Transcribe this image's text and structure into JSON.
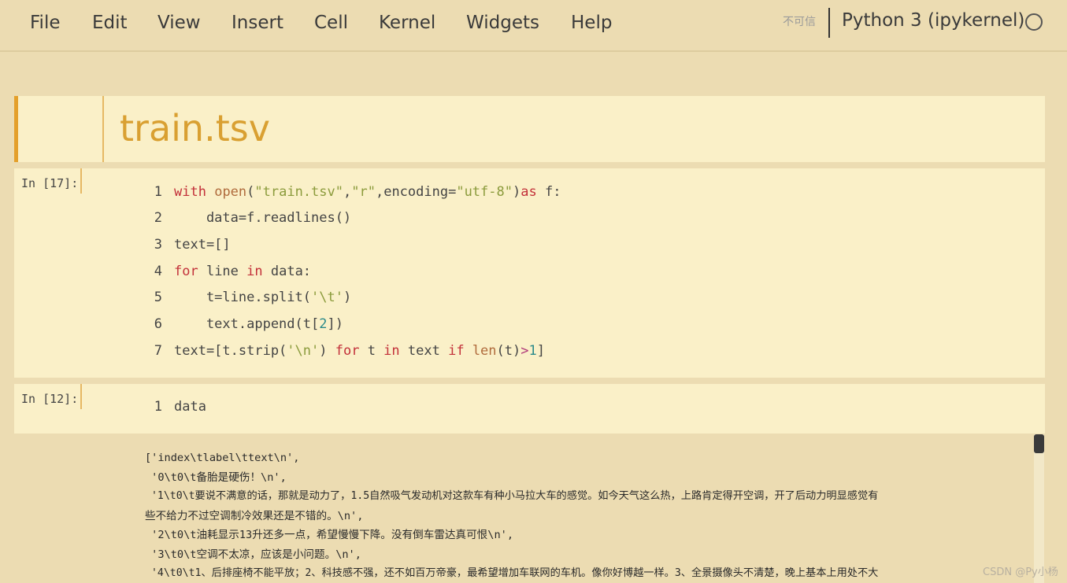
{
  "menubar": {
    "items": [
      "File",
      "Edit",
      "View",
      "Insert",
      "Cell",
      "Kernel",
      "Widgets",
      "Help"
    ],
    "trust_label": "不可信",
    "kernel_name": "Python 3 (ipykernel)"
  },
  "markdown_cell": {
    "title": "train.tsv"
  },
  "cells": [
    {
      "prompt": "In  [17]:",
      "line_numbers": [
        "1",
        "2",
        "3",
        "4",
        "5",
        "6",
        "7"
      ]
    },
    {
      "prompt": "In  [12]:",
      "line_numbers": [
        "1"
      ],
      "code": "data"
    }
  ],
  "output": {
    "lines": [
      "['index\\tlabel\\ttext\\n',",
      " '0\\t0\\t备胎是硬伤！\\n',",
      " '1\\t0\\t要说不满意的话，那就是动力了，1.5自然吸气发动机对这款车有种小马拉大车的感觉。如今天气这么热，上路肯定得开空调，开了后动力明显感觉有",
      "些不给力不过空调制冷效果还是不错的。\\n',",
      " '2\\t0\\t油耗显示13升还多一点，希望慢慢下降。没有倒车雷达真可恨\\n',",
      " '3\\t0\\t空调不太凉，应该是小问题。\\n',",
      " '4\\t0\\t1、后排座椅不能平放；2、科技感不强，还不如百万帝豪，最希望增加车联网的车机。像你好博越一样。3、全景摄像头不清楚，晚上基本上用处不大"
    ],
    "watermark": "CSDN @Py小杨"
  },
  "colors": {
    "background": "#ecdcb2",
    "cell_background": "#faf0c8",
    "accent": "#e4a02b",
    "keyword": "#c3313a",
    "string": "#8b9b3c"
  }
}
